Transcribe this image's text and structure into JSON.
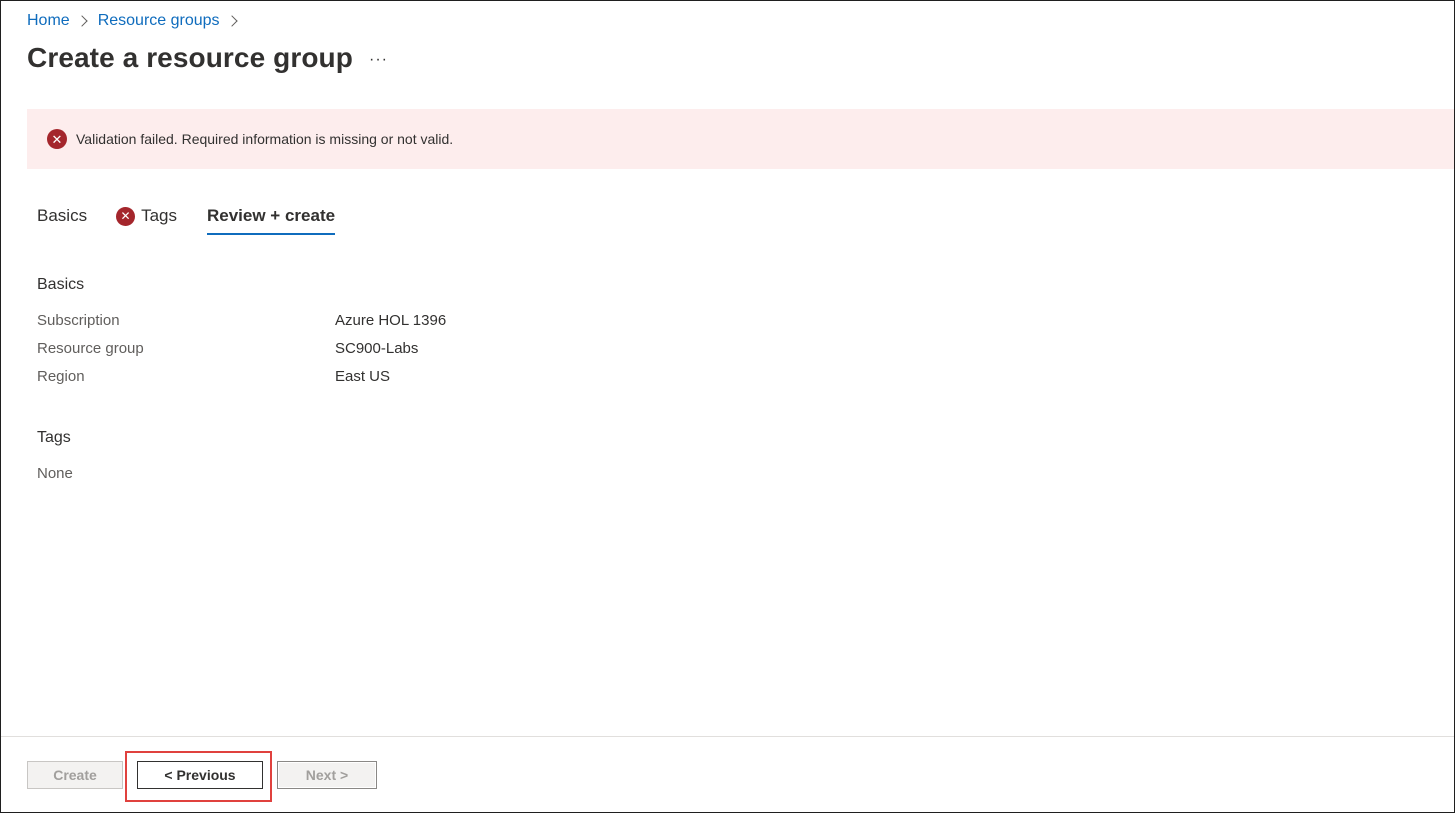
{
  "breadcrumb": {
    "home": "Home",
    "resource_groups": "Resource groups"
  },
  "header": {
    "title": "Create a resource group",
    "more_label": "···"
  },
  "error_banner": {
    "icon": "error-circle-icon",
    "message": "Validation failed. Required information is missing or not valid."
  },
  "tabs": [
    {
      "label": "Basics",
      "error": false,
      "selected": false
    },
    {
      "label": "Tags",
      "error": true,
      "selected": false
    },
    {
      "label": "Review + create",
      "error": false,
      "selected": true
    }
  ],
  "summary": {
    "basics": {
      "heading": "Basics",
      "rows": [
        {
          "label": "Subscription",
          "value": "Azure HOL 1396"
        },
        {
          "label": "Resource group",
          "value": "SC900-Labs"
        },
        {
          "label": "Region",
          "value": "East US"
        }
      ]
    },
    "tags": {
      "heading": "Tags",
      "value": "None"
    }
  },
  "footer": {
    "create_label": "Create",
    "previous_label": "< Previous",
    "next_label": "Next >",
    "highlight_color": "#e0413e"
  },
  "colors": {
    "accent": "#0f6cbd",
    "error": "#a4262c",
    "error_background": "#fdeded"
  }
}
